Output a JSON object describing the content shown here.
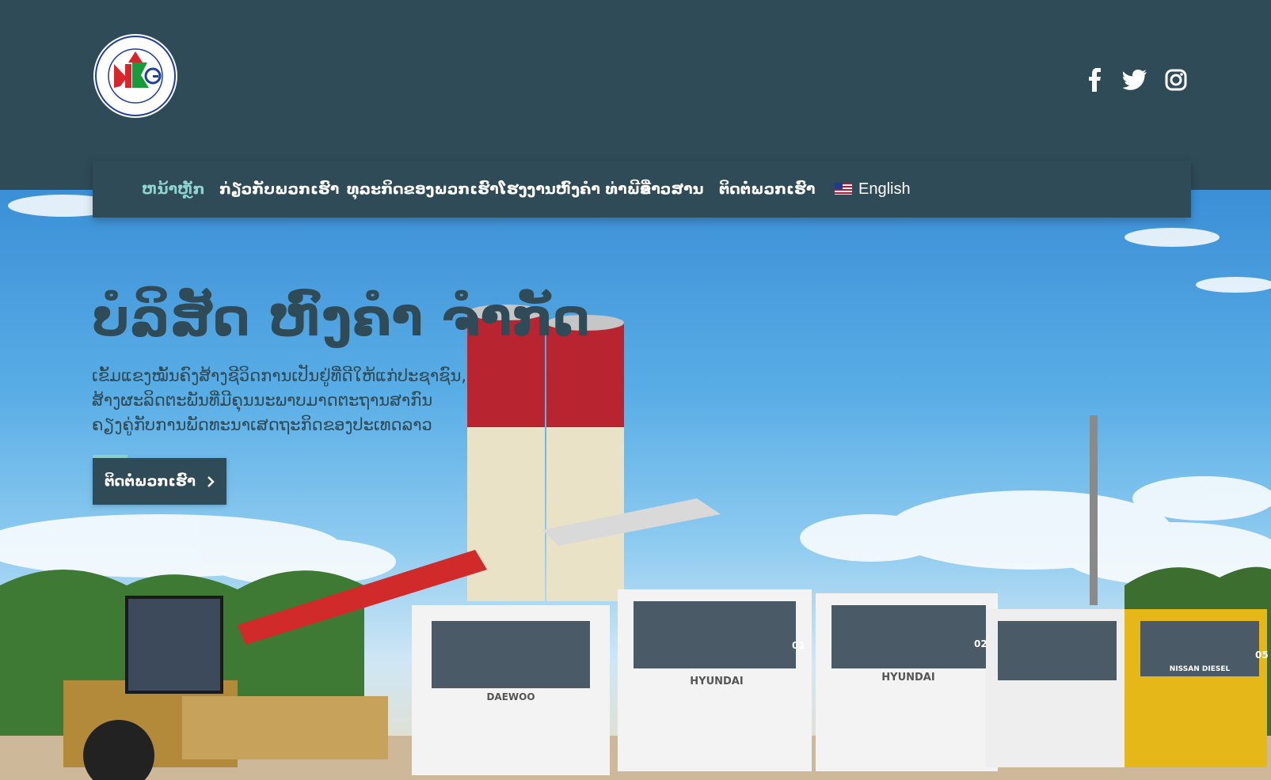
{
  "brand": {
    "logo_name": "company-logo",
    "logo_ring_text": "ກຸ່ມບໍລິສັດ ຫົງຄຳ ພາກໃຕ້ · HONGKHAM PAKTAI COMPANY GROUP",
    "logo_letters": "HKG"
  },
  "social": [
    {
      "name": "facebook-icon"
    },
    {
      "name": "twitter-icon"
    },
    {
      "name": "instagram-icon"
    }
  ],
  "nav": {
    "items": [
      {
        "label": "ຫນ້າຫຼັກ",
        "active": true
      },
      {
        "label": "ກ່ຽວກັບພວກເຮົາ"
      },
      {
        "label": "ທຸລະກິດຂອງພວກເຮົາ"
      },
      {
        "label": "ໂຮງງານຫົງຄຳ ທ່າພີອີ"
      },
      {
        "label": "ຂ່າວສານ"
      },
      {
        "label": "ຕິດຕໍ່ພວກເຮົາ"
      }
    ],
    "language": {
      "label": "English",
      "flag": "us-flag-icon"
    }
  },
  "hero": {
    "title": "ບໍລິສັດ ຫົງຄຳ ຈຳກັດ",
    "description": [
      "ເຂັ້ມແຂງໝັ້ນຄົງສ້າງຊີວິດການເປັນຢູ່ທີ່ດີໃຫ້ແກ່ປະຊາຊົນ,",
      "ສ້າງຜະລິດຕະພັນທີ່ມີຄຸນນະພາບມາດຕະຖານສາກົນ",
      "ຄຽງຄູ່ກັບການພັດທະນາເສດຖະກິດຂອງປະເທດລາວ"
    ],
    "cta_label": "ຕິດຕໍ່ພວກເຮົາ",
    "truck_labels": [
      "DAEWOO",
      "HYUNDAI",
      "HYUNDAI",
      "NISSAN DIESEL"
    ],
    "truck_numbers": [
      "01",
      "02",
      "05"
    ]
  },
  "colors": {
    "header_bg": "#2f4b57",
    "accent": "#8fd3cf",
    "text_on_dark": "#ffffff"
  }
}
